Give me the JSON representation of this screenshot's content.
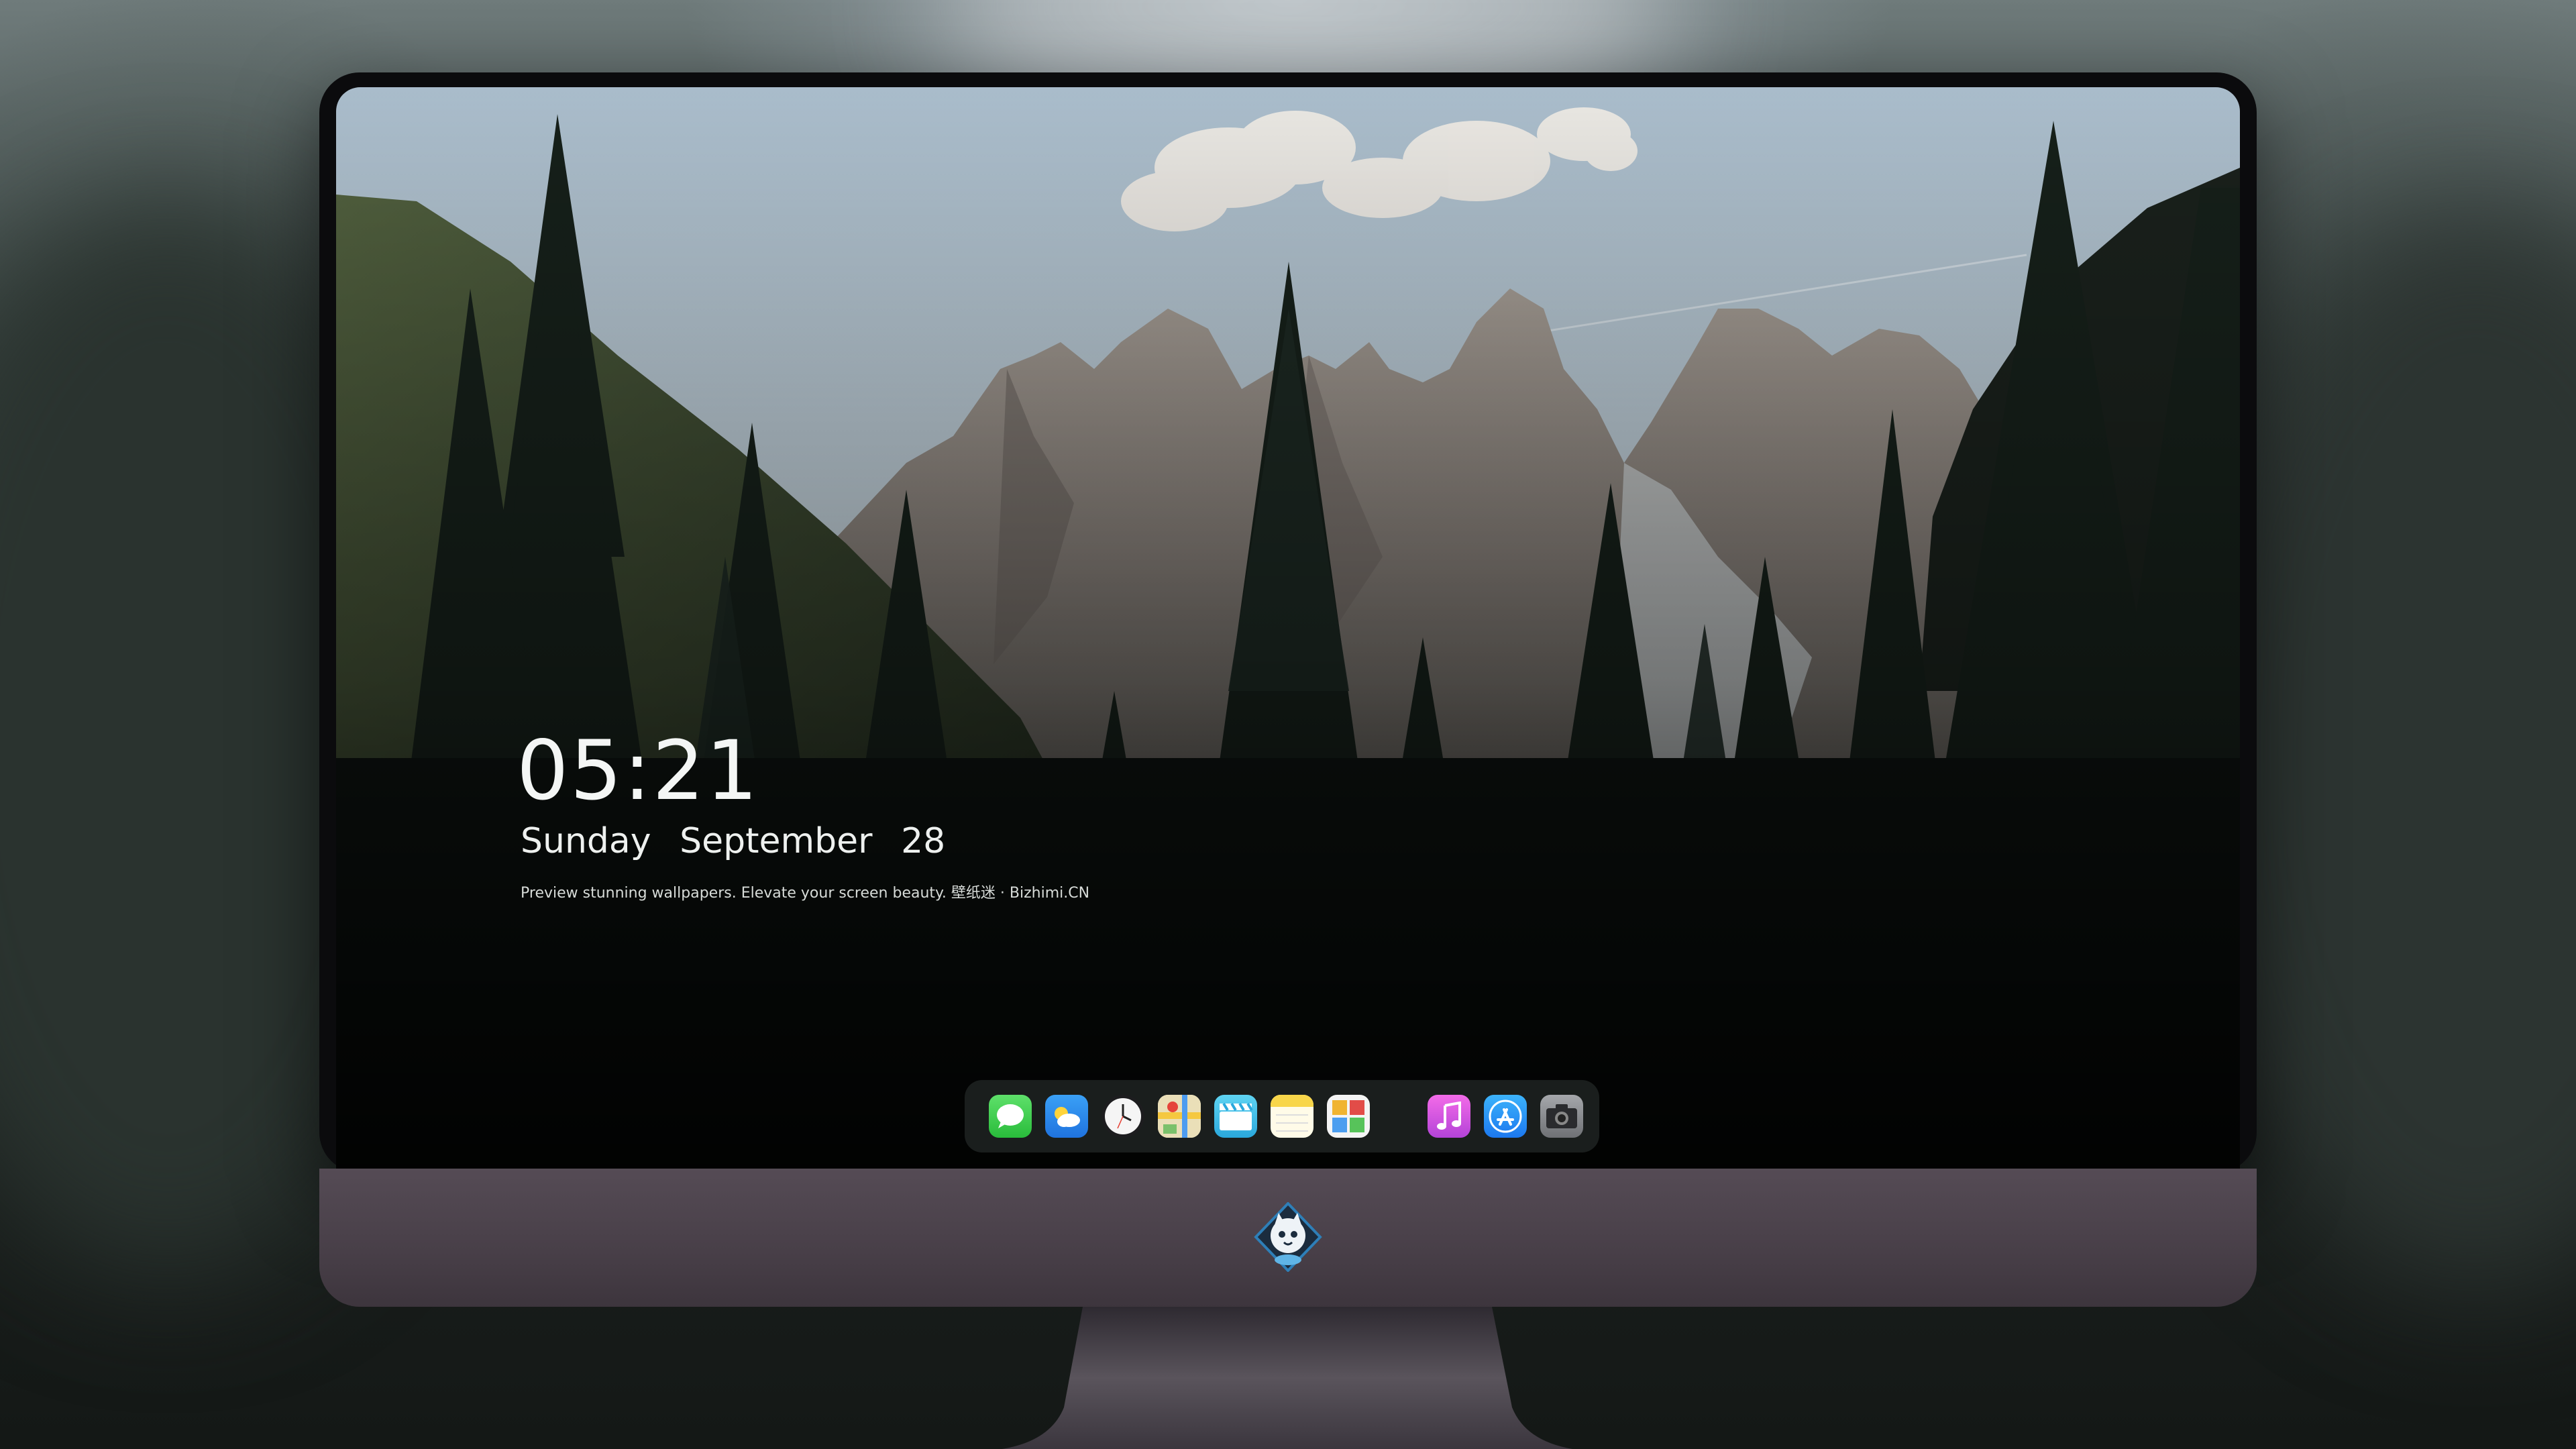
{
  "lock_screen": {
    "time": "05:21",
    "weekday": "Sunday",
    "month": "September",
    "day": "28",
    "tagline": "Preview stunning wallpapers. Elevate your screen beauty. 壁纸迷 · Bizhimi.CN"
  },
  "dock": {
    "apps": [
      {
        "name": "messages",
        "icon": "messages-icon",
        "color": "#3ccd4b"
      },
      {
        "name": "weather",
        "icon": "weather-icon",
        "color": "#2f8cf0"
      },
      {
        "name": "clock",
        "icon": "clock-icon",
        "color": "#f2f2f2"
      },
      {
        "name": "maps",
        "icon": "maps-icon",
        "color": "#f1c94a"
      },
      {
        "name": "video",
        "icon": "clapperboard-icon",
        "color": "#39c0e8"
      },
      {
        "name": "notes",
        "icon": "notes-icon",
        "color": "#f7d54c"
      },
      {
        "name": "photos",
        "icon": "photos-icon",
        "color": "#f1f1f1"
      },
      {
        "name": "music",
        "icon": "music-icon",
        "color": "#d14cd8"
      },
      {
        "name": "app-store",
        "icon": "app-store-icon",
        "color": "#2596f5"
      },
      {
        "name": "camera",
        "icon": "camera-icon",
        "color": "#8d8f93"
      }
    ]
  },
  "monitor": {
    "bezel_color": "#0b0b0d",
    "chin_color": "#4a414a",
    "logo": "mascot-badge-logo"
  }
}
